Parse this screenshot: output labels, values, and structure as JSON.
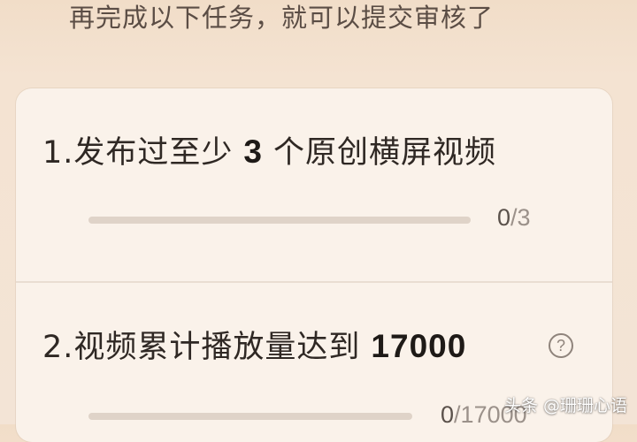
{
  "header": {
    "text": "再完成以下任务，就可以提交审核了"
  },
  "tasks": [
    {
      "index": "1.",
      "prefix": "发布过至少",
      "number": "3",
      "suffix": "个原创横屏视频",
      "progress": {
        "current": "0",
        "separator": "/",
        "total": "3",
        "fraction": 0
      }
    },
    {
      "index": "2.",
      "prefix": "视频累计播放量达到",
      "number": "17000",
      "suffix": "",
      "help_icon": "question-circle-icon",
      "progress": {
        "current": "0",
        "separator": "/",
        "total": "17000",
        "fraction": 0
      }
    }
  ],
  "watermark": {
    "text": "头条 @珊珊心语"
  },
  "colors": {
    "background": "#f3e4d6",
    "card": "#faf2ea",
    "track": "#dfd3c8",
    "fill": "#d18a4c"
  }
}
